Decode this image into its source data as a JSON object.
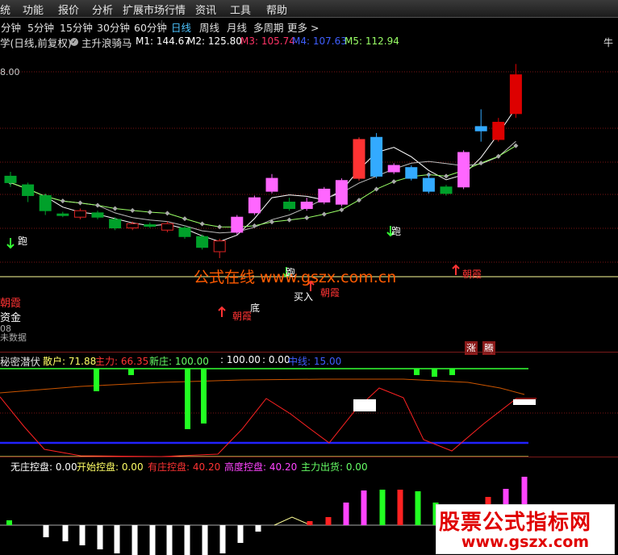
{
  "menubar": {
    "items": [
      "统",
      "功能",
      "报价",
      "分析",
      "扩展市场行情",
      "资讯",
      "工具",
      "帮助"
    ]
  },
  "periodbar": {
    "items": [
      "分钟",
      "5分钟",
      "15分钟",
      "30分钟",
      "60分钟",
      "日线",
      "周线",
      "月线",
      "多周期",
      "更多 >"
    ],
    "active": "日线"
  },
  "main_panel": {
    "stock_title": "学(日线,前复权)",
    "indicator_name": "主升浪骑马",
    "ma_labels": [
      {
        "text": "M1: 144.67",
        "color": "#ffffff"
      },
      {
        "text": "M2: 125.80",
        "color": "#ffffff"
      },
      {
        "text": "M3: 105.74",
        "color": "#ff3366"
      },
      {
        "text": "M4: 107.63",
        "color": "#3f5fff"
      },
      {
        "text": "M5: 112.94",
        "color": "#99ff66"
      }
    ],
    "right_label": "牛",
    "price_label": "8.00",
    "left_labels": {
      "zhaoxia": "朝霞",
      "zijin": "资金",
      "num": "08",
      "nodata": "未数据"
    },
    "signals": {
      "pao": "跑",
      "di": "底",
      "mairu": "买入",
      "zhaoxia": "朝霞"
    },
    "bottom_tags": {
      "zhang": "涨",
      "teng": "腾"
    },
    "watermark_text": "公式在线 www.gszx.com.cn",
    "candles": [
      {
        "o": 129,
        "c": 126,
        "h": 131,
        "l": 124
      },
      {
        "o": 125,
        "c": 120,
        "h": 126,
        "l": 117
      },
      {
        "o": 120,
        "c": 113,
        "h": 121,
        "l": 111
      },
      {
        "o": 111.5,
        "c": 111,
        "h": 112.5,
        "l": 110
      },
      {
        "o": 110,
        "c": 113,
        "h": 114,
        "l": 109
      },
      {
        "o": 112,
        "c": 110,
        "h": 113,
        "l": 109
      },
      {
        "o": 109,
        "c": 105,
        "h": 110,
        "l": 104
      },
      {
        "o": 105,
        "c": 107,
        "h": 108,
        "l": 104
      },
      {
        "o": 106.5,
        "c": 106,
        "h": 107.5,
        "l": 105
      },
      {
        "o": 104,
        "c": 107,
        "h": 108,
        "l": 103
      },
      {
        "o": 105,
        "c": 101,
        "h": 106,
        "l": 100
      },
      {
        "o": 101,
        "c": 96,
        "h": 102,
        "l": 95
      },
      {
        "o": 94,
        "c": 99,
        "h": 100,
        "l": 91
      },
      {
        "o": 103,
        "c": 110,
        "h": 111,
        "l": 102
      },
      {
        "o": 112,
        "c": 119,
        "h": 120,
        "l": 111
      },
      {
        "o": 122,
        "c": 128,
        "h": 130,
        "l": 121
      },
      {
        "o": 117,
        "c": 114,
        "h": 119,
        "l": 113
      },
      {
        "o": 114,
        "c": 117,
        "h": 119,
        "l": 113
      },
      {
        "o": 117,
        "c": 123,
        "h": 124,
        "l": 116
      },
      {
        "o": 116,
        "c": 127,
        "h": 128,
        "l": 115
      },
      {
        "o": 128,
        "c": 146,
        "h": 147,
        "l": 127
      },
      {
        "o": 129,
        "c": 147,
        "h": 149,
        "l": 128
      },
      {
        "o": 131,
        "c": 134,
        "h": 135,
        "l": 130
      },
      {
        "o": 128,
        "c": 133,
        "h": 134,
        "l": 127
      },
      {
        "o": 122,
        "c": 128,
        "h": 130,
        "l": 121
      },
      {
        "o": 124,
        "c": 121,
        "h": 125,
        "l": 120
      },
      {
        "o": 124,
        "c": 140,
        "h": 141,
        "l": 123
      },
      {
        "o": 150,
        "c": 152,
        "h": 160,
        "l": 145
      },
      {
        "o": 146,
        "c": 154,
        "h": 156,
        "l": 145
      },
      {
        "o": 158,
        "c": 176,
        "h": 181,
        "l": 156
      }
    ]
  },
  "sub1": {
    "title": "秘密潜伏",
    "labels": [
      {
        "text": "散户: 71.88",
        "color": "#ffff66"
      },
      {
        "text": "主力: 66.35",
        "color": "#ff3333"
      },
      {
        "text": "新庄: 100.00",
        "color": "#66ff66"
      },
      {
        "text": ": 100.00",
        "color": "#ffffff"
      },
      {
        "text": ": 0.00",
        "color": "#ffffff"
      },
      {
        "text": "中线: 15.00",
        "color": "#3f5fff"
      }
    ]
  },
  "sub2": {
    "labels": [
      {
        "text": "无庄控盘: 0.00",
        "color": "#ffffff"
      },
      {
        "text": "开始控盘: 0.00",
        "color": "#ffff66"
      },
      {
        "text": "有庄控盘: 40.20",
        "color": "#ff3333"
      },
      {
        "text": "高度控盘: 40.20",
        "color": "#ff44ff"
      },
      {
        "text": "主力出货: 0.00",
        "color": "#66ff66"
      }
    ]
  },
  "watermark": {
    "title": "股票公式指标网",
    "url": "www.gszx.com"
  }
}
